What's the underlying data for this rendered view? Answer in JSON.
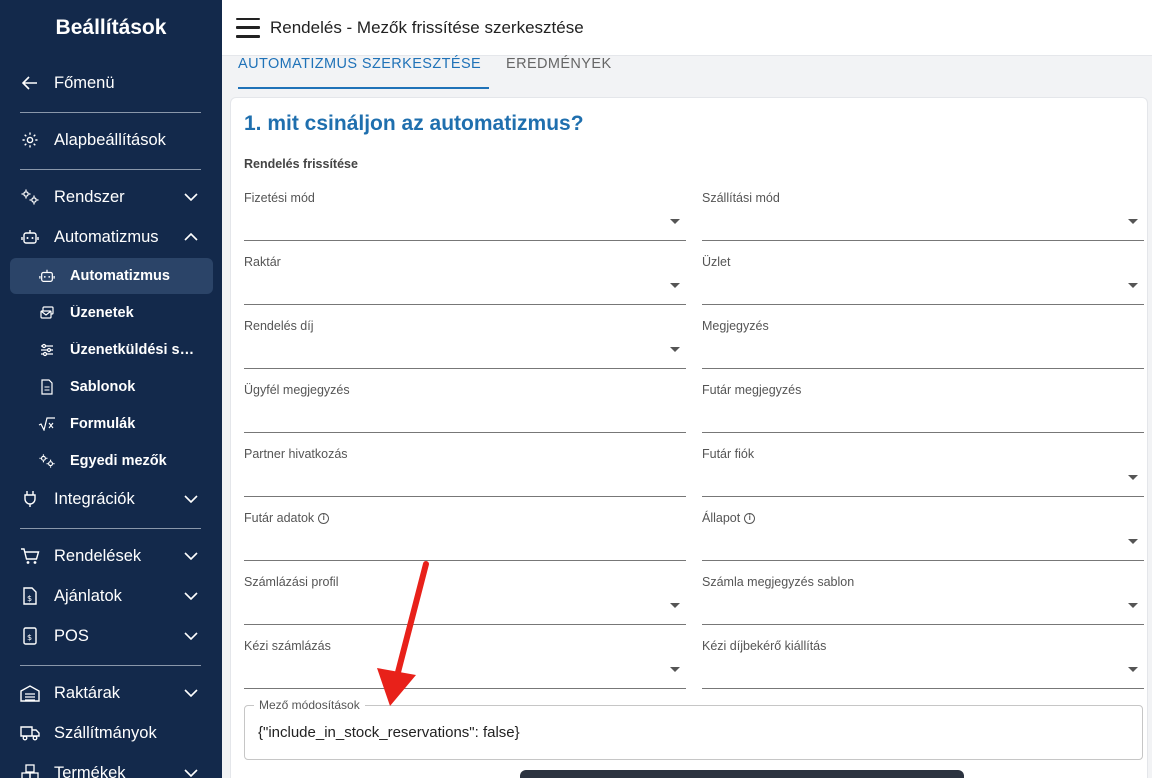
{
  "sidebar": {
    "title": "Beállítások",
    "back": {
      "label": "Főmenü",
      "icon": "arrow-left-icon"
    },
    "basic": {
      "label": "Alapbeállítások",
      "icon": "gear-icon"
    },
    "groups": {
      "rendszer": {
        "label": "Rendszer",
        "icon": "gears-icon",
        "expanded": false
      },
      "automatizmus": {
        "label": "Automatizmus",
        "icon": "robot-icon",
        "expanded": true
      },
      "integraciok": {
        "label": "Integrációk",
        "icon": "plug-icon",
        "expanded": false
      },
      "rendelesek": {
        "label": "Rendelések",
        "icon": "cart-icon",
        "expanded": false
      },
      "ajanlatok": {
        "label": "Ajánlatok",
        "icon": "invoice-icon",
        "expanded": false
      },
      "pos": {
        "label": "POS",
        "icon": "pos-icon",
        "expanded": false
      },
      "raktarak": {
        "label": "Raktárak",
        "icon": "warehouse-icon",
        "expanded": false
      },
      "szallitmanyok": {
        "label": "Szállítmányok",
        "icon": "truck-icon"
      },
      "termekek": {
        "label": "Termékek",
        "icon": "boxes-icon",
        "expanded": false
      }
    },
    "subitems": [
      {
        "label": "Automatizmus",
        "icon": "robot-icon",
        "active": true
      },
      {
        "label": "Üzenetek",
        "icon": "messages-icon",
        "active": false
      },
      {
        "label": "Üzenetküldési sza…",
        "icon": "sliders-icon",
        "active": false
      },
      {
        "label": "Sablonok",
        "icon": "document-icon",
        "active": false
      },
      {
        "label": "Formulák",
        "icon": "sqrt-icon",
        "active": false
      },
      {
        "label": "Egyedi mezők",
        "icon": "gears-icon",
        "active": false
      }
    ]
  },
  "header": {
    "title": "Rendelés - Mezők frissítése szerkesztése"
  },
  "tabs": {
    "edit": "AUTOMATIZMUS SZERKESZTÉSE",
    "results": "EREDMÉNYEK"
  },
  "form": {
    "heading": "1. mit csináljon az automatizmus?",
    "section": "Rendelés frissítése",
    "fields": {
      "fizetesi_mod": "Fizetési mód",
      "szallitasi_mod": "Szállítási mód",
      "raktar": "Raktár",
      "uzlet": "Üzlet",
      "rendeles_dij": "Rendelés díj",
      "megjegyzes": "Megjegyzés",
      "ugyfel_megjegyzes": "Ügyfél megjegyzés",
      "futar_megjegyzes": "Futár megjegyzés",
      "partner_hivatkozas": "Partner hivatkozás",
      "futar_fiok": "Futár fiók",
      "futar_adatok": "Futár adatok",
      "allapot": "Állapot",
      "szamlazasi_profil": "Számlázási profil",
      "szamla_megjegyzes_sablon": "Számla megjegyzés sablon",
      "kezi_szamlazas": "Kézi számlázás",
      "kezi_dijbekero": "Kézi díjbekérő kiállítás"
    },
    "info_icon_glyph": "i",
    "modifications": {
      "label": "Mező módosítások",
      "value": "{\"include_in_stock_reservations\": false}"
    }
  },
  "colors": {
    "sidebar_bg": "#13294b",
    "accent": "#1f72b8",
    "arrow": "#e8211a"
  }
}
